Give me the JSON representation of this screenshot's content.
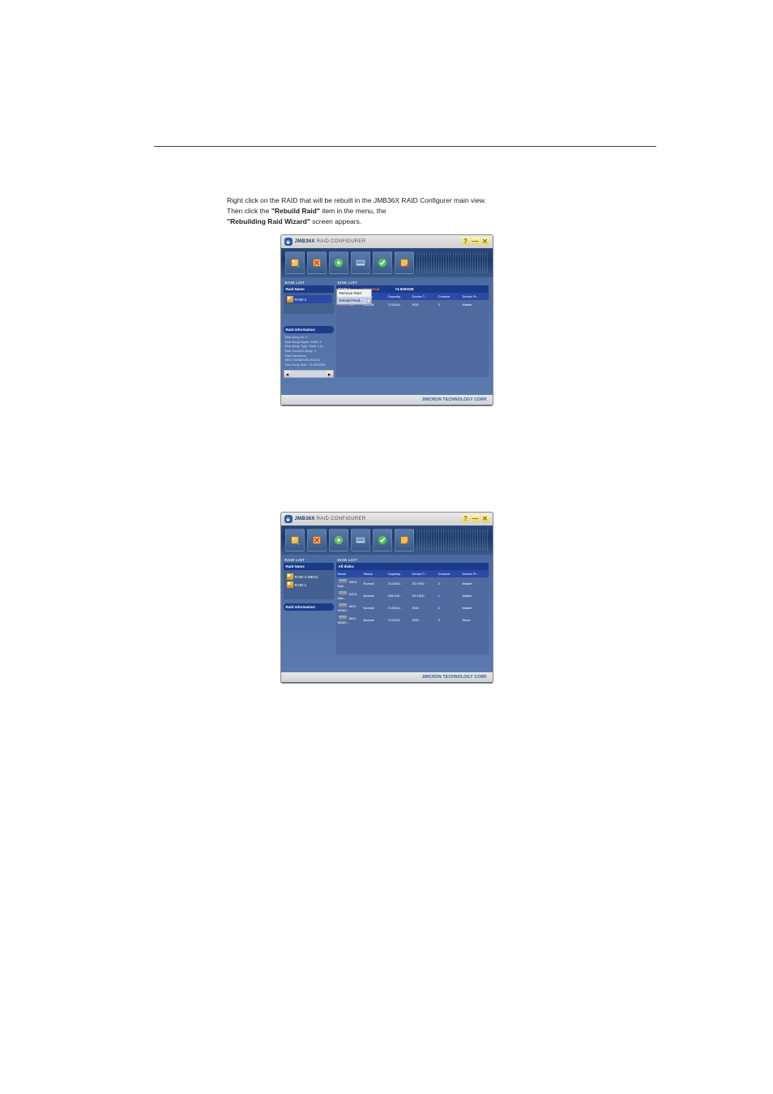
{
  "page": {
    "text_line1": "Right click on the RAID that will be rebuilt in the JMB36X RAID Configurer main view.",
    "text_line2_pre": "Then click the ",
    "text_line2_bold": "Rebuild Raid",
    "text_line2_post": " item in the menu, the ",
    "text_line3_bold": "Rebuilding Raid Wizard",
    "text_line3_post": " screen appears."
  },
  "app": {
    "title_bold": "JMB36X",
    "title_thin": "RAID CONFIGURER",
    "footer": "JMICRON TECHNOLOGY CORP."
  },
  "win_controls": {
    "help": "?",
    "min": "—",
    "close": "✕"
  },
  "context_menu": {
    "item1": "Remove Raid",
    "item2": "Rebuild Raid..."
  },
  "left": {
    "raid_list": "RAID LIST",
    "raid_name": "Raid Name",
    "raid_info": "Raid Information:"
  },
  "right": {
    "disk_list": "DISK LIST",
    "columns": {
      "name": "Name",
      "status": "Status",
      "capacity": "Capacity",
      "device_type": "Device T...",
      "channel": "Channel",
      "device_pri": "Device Pr..."
    }
  },
  "win1": {
    "raid_item": "RAID-1",
    "info_lines": [
      "Disk Array ID: 3",
      "Disk Array Name: RAID-1",
      "Disk Array Type: Raid 1 (A...",
      "Disk Count in Array: 1",
      "Disk Members:",
      "  WDC WD800JB-00JJC0",
      "Disk Array Size: 74.5293GB"
    ],
    "header": {
      "name": "RAID-1",
      "status": "Abnormal",
      "cap": "74.5293GB"
    },
    "rows": [
      {
        "name": "00...",
        "status": "Normal",
        "cap": "74.5304...",
        "devt": "HDD",
        "chan": "3",
        "devp": "Master"
      }
    ]
  },
  "win2": {
    "raid_items": [
      "RAID-1-SIES1",
      "RAID-1"
    ],
    "header": {
      "name": "All disks:"
    },
    "rows": [
      {
        "name": "SATA Max...",
        "status": "Normal",
        "cap": "76.3340...",
        "devt": "3G HDD",
        "chan": "3",
        "devp": "Master"
      },
      {
        "name": "SATA Max...",
        "status": "Normal",
        "cap": "189.920...",
        "devt": "3G HDD",
        "chan": "1",
        "devp": "Master"
      },
      {
        "name": "WDC WD80...",
        "status": "Normal",
        "cap": "74.5304...",
        "devt": "HDD",
        "chan": "3",
        "devp": "Master"
      },
      {
        "name": "WDC WD80...",
        "status": "Normal",
        "cap": "74.5293...",
        "devt": "HDD",
        "chan": "3",
        "devp": "Slave"
      }
    ]
  }
}
